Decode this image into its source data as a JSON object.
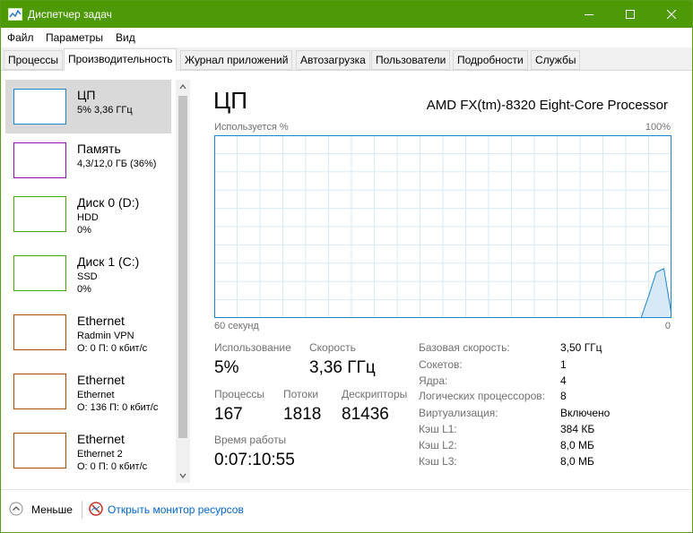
{
  "window": {
    "title": "Диспетчер задач",
    "accent": "#4e9a06"
  },
  "menu": [
    "Файл",
    "Параметры",
    "Вид"
  ],
  "tabs": [
    "Процессы",
    "Производительность",
    "Журнал приложений",
    "Автозагрузка",
    "Пользователи",
    "Подробности",
    "Службы"
  ],
  "sidebar": {
    "items": [
      {
        "name": "ЦП",
        "line1": "5% 3,36 ГГц",
        "line2": "",
        "color": "#1a85c8"
      },
      {
        "name": "Память",
        "line1": "4,3/12,0 ГБ (36%)",
        "line2": "",
        "color": "#8b12ae"
      },
      {
        "name": "Диск 0 (D:)",
        "line1": "HDD",
        "line2": "0%",
        "color": "#4da60c"
      },
      {
        "name": "Диск 1 (C:)",
        "line1": "SSD",
        "line2": "0%",
        "color": "#4da60c"
      },
      {
        "name": "Ethernet",
        "line1": "Radmin VPN",
        "line2": "О: 0 П: 0 кбит/с",
        "color": "#a74f01"
      },
      {
        "name": "Ethernet",
        "line1": "Ethernet",
        "line2": "О: 136 П: 0 кбит/с",
        "color": "#a74f01"
      },
      {
        "name": "Ethernet",
        "line1": "Ethernet 2",
        "line2": "О: 0 П: 0 кбит/с",
        "color": "#a74f01"
      }
    ]
  },
  "main": {
    "title": "ЦП",
    "processor": "AMD FX(tm)-8320 Eight-Core Processor",
    "graph_label_tl": "Используется %",
    "graph_label_tr": "100%",
    "graph_label_bl": "60 секунд",
    "graph_label_br": "0",
    "graph_color": "#1a85c8"
  },
  "chart_data": {
    "type": "area",
    "title": "",
    "xlabel": "60 секунд",
    "ylabel": "Используется %",
    "xlim": [
      60,
      0
    ],
    "ylim": [
      0,
      100
    ],
    "x": [
      60,
      4,
      3,
      2,
      1,
      0
    ],
    "values": [
      0,
      0,
      12,
      25,
      27,
      2
    ]
  },
  "stats": {
    "usage_label": "Использование",
    "usage_value": "5%",
    "speed_label": "Скорость",
    "speed_value": "3,36 ГГц",
    "processes_label": "Процессы",
    "processes_value": "167",
    "threads_label": "Потоки",
    "threads_value": "1818",
    "handles_label": "Дескрипторы",
    "handles_value": "81436",
    "uptime_label": "Время работы",
    "uptime_value": "0:07:10:55"
  },
  "specs": [
    {
      "label": "Базовая скорость:",
      "value": "3,50 ГГц"
    },
    {
      "label": "Сокетов:",
      "value": "1"
    },
    {
      "label": "Ядра:",
      "value": "4"
    },
    {
      "label": "Логических процессоров:",
      "value": "8"
    },
    {
      "label": "Виртуализация:",
      "value": "Включено"
    },
    {
      "label": "Кэш L1:",
      "value": "384 КБ"
    },
    {
      "label": "Кэш L2:",
      "value": "8,0 МБ"
    },
    {
      "label": "Кэш L3:",
      "value": "8,0 МБ"
    }
  ],
  "footer": {
    "less": "Меньше",
    "resource_monitor": "Открыть монитор ресурсов"
  }
}
